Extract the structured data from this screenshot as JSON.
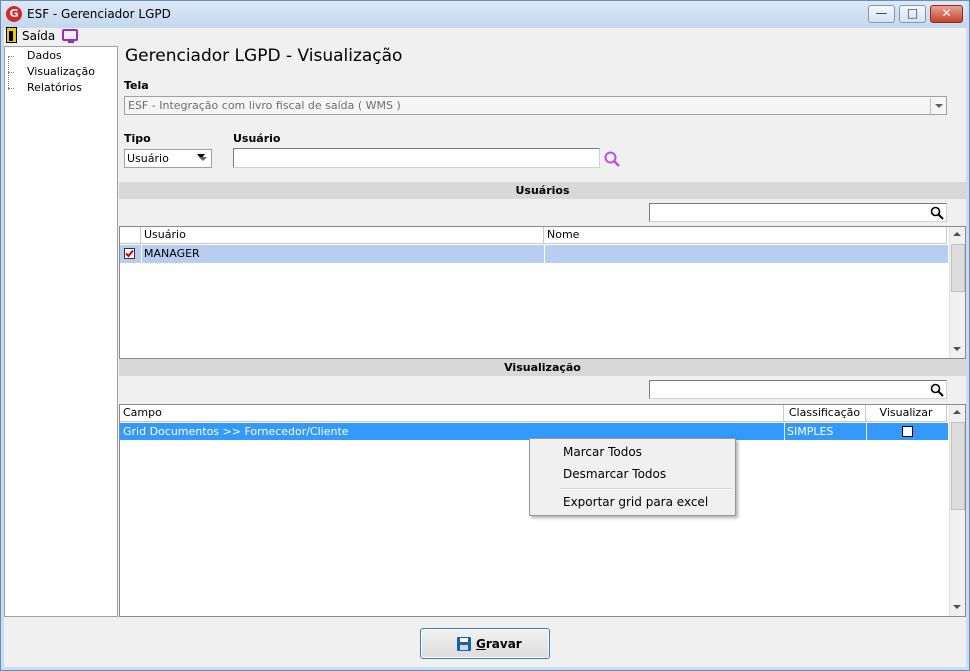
{
  "window": {
    "title": "ESF - Gerenciador LGPD",
    "logo_letter": "G"
  },
  "menu": {
    "exit_label": "Saída"
  },
  "tree": {
    "items": [
      "Dados",
      "Visualização",
      "Relatórios"
    ]
  },
  "page_title": "Gerenciador LGPD - Visualização",
  "tela": {
    "label": "Tela",
    "value": "ESF - Integração com livro fiscal de saída ( WMS )"
  },
  "tipo": {
    "label": "Tipo",
    "value": "Usuário"
  },
  "usuario": {
    "label": "Usuário",
    "value": ""
  },
  "usuarios_section": {
    "title": "Usuários",
    "search_value": "",
    "columns": [
      "Usuário",
      "Nome"
    ],
    "rows": [
      {
        "checked": true,
        "usuario": "MANAGER",
        "nome": ""
      }
    ]
  },
  "visualizacao_section": {
    "title": "Visualização",
    "search_value": "",
    "columns": [
      "Campo",
      "Classificação",
      "Visualizar"
    ],
    "rows": [
      {
        "campo": "Grid Documentos >> Fornecedor/Cliente",
        "classificacao": "SIMPLES",
        "visualizar": false
      }
    ]
  },
  "context_menu": {
    "items": [
      "Marcar Todos",
      "Desmarcar Todos",
      "Exportar grid para excel"
    ]
  },
  "save_button": {
    "label": "Gravar",
    "accelerator": "G"
  },
  "colors": {
    "selection": "#3399ff",
    "accent_purple": "#9b2bd0",
    "logo_red": "#d8262d",
    "save_blue": "#1f5fa8"
  }
}
